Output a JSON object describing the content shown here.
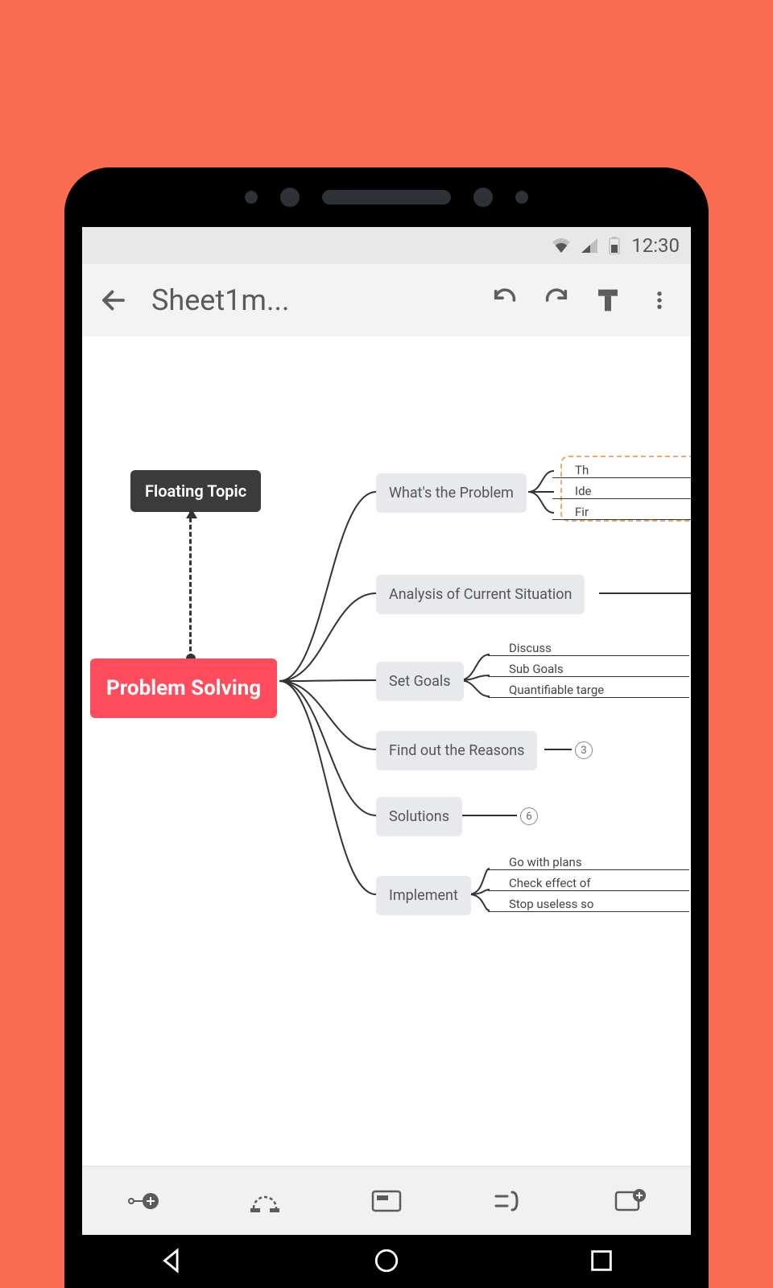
{
  "status": {
    "time": "12:30"
  },
  "appbar": {
    "title": "Sheet1m..."
  },
  "mindmap": {
    "central": "Problem Solving",
    "floating": "Floating Topic",
    "nodes": [
      {
        "label": "What's the Problem",
        "children": [
          "Th",
          "Ide",
          "Fir"
        ],
        "selected_group": true
      },
      {
        "label": "Analysis of Current Situation"
      },
      {
        "label": "Set Goals",
        "children": [
          "Discuss",
          "Sub Goals",
          "Quantifiable targe"
        ]
      },
      {
        "label": "Find out the Reasons",
        "count": "3"
      },
      {
        "label": "Solutions",
        "count": "6"
      },
      {
        "label": "Implement",
        "children": [
          "Go with plans",
          "Check effect of",
          "Stop useless so"
        ]
      }
    ]
  }
}
